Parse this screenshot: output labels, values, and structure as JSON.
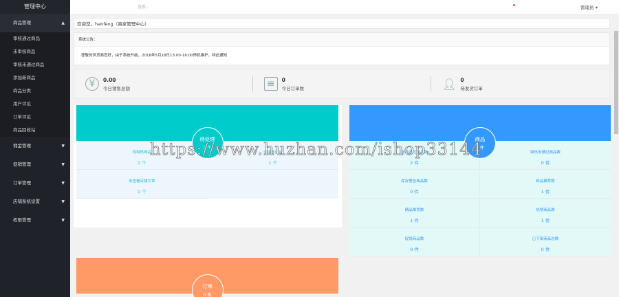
{
  "sidebar": {
    "title": "管理中心",
    "open_group": "商品管理",
    "sub_items": [
      "审核通过商品",
      "未审核商品",
      "审核未通过商品",
      "添加新商品",
      "商品分类",
      "用户评论",
      "订单评论",
      "商品回收站"
    ],
    "groups": [
      "佣金管理",
      "促销管理",
      "订单管理",
      "店铺系统设置",
      "权限管理"
    ]
  },
  "topbar": {
    "search_placeholder": "搜索...",
    "user": "管理员"
  },
  "welcome": "欢迎您，hanfeng（商家管理中心）",
  "notice": {
    "title": "系统公告：",
    "text": "尊敬的供货商您好，由于系统升级，2018年5月18日13:00-16:00停机维护，特此通知"
  },
  "stats": [
    {
      "value": "0.00",
      "label": "今日销售总额"
    },
    {
      "value": "0",
      "label": "今日订单数"
    },
    {
      "value": "0",
      "label": "待发货订单"
    }
  ],
  "pending": {
    "title": "待处理",
    "count": "2 个",
    "color": "#00cccc",
    "items": [
      {
        "label": "待审核商品",
        "value": "1 个"
      },
      {
        "label": "未审核评论",
        "value": "1 个"
      },
      {
        "label": "未查看店铺文章",
        "value": "1 个"
      }
    ]
  },
  "goods": {
    "title": "商品",
    "count": "2 件",
    "color": "#3399ff",
    "items": [
      {
        "label": "审核通过商品数",
        "value": "2 件"
      },
      {
        "label": "审核未通过商品数",
        "value": "0 件"
      },
      {
        "label": "库存警告商品数",
        "value": "0 件"
      },
      {
        "label": "新品推荐数",
        "value": "1 件"
      },
      {
        "label": "精品推荐数",
        "value": "1 件"
      },
      {
        "label": "热销商品数",
        "value": "1 件"
      },
      {
        "label": "促销商品数",
        "value": "0 件"
      },
      {
        "label": "已下架商品总数",
        "value": "0 件"
      }
    ]
  },
  "orders": {
    "title": "订单",
    "count": "0 笔",
    "color": "#ff9966"
  },
  "watermark": "https://www.huzhan.com/ishop33144"
}
